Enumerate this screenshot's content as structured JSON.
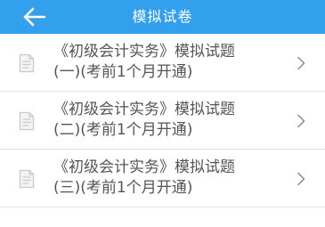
{
  "header": {
    "title": "模拟试卷",
    "back_icon": "arrow-left-icon",
    "background_color": "#32a0ec",
    "text_color": "#ffffff"
  },
  "exam_list": {
    "item_icon": "document-icon",
    "chevron_icon": "chevron-right-icon",
    "items": [
      {
        "line1": "《初级会计实务》模拟试题",
        "line2": "(一)(考前1个月开通)"
      },
      {
        "line1": "《初级会计实务》模拟试题",
        "line2": "(二)(考前1个月开通)"
      },
      {
        "line1": "《初级会计实务》模拟试题",
        "line2": "(三)(考前1个月开通)"
      }
    ]
  }
}
